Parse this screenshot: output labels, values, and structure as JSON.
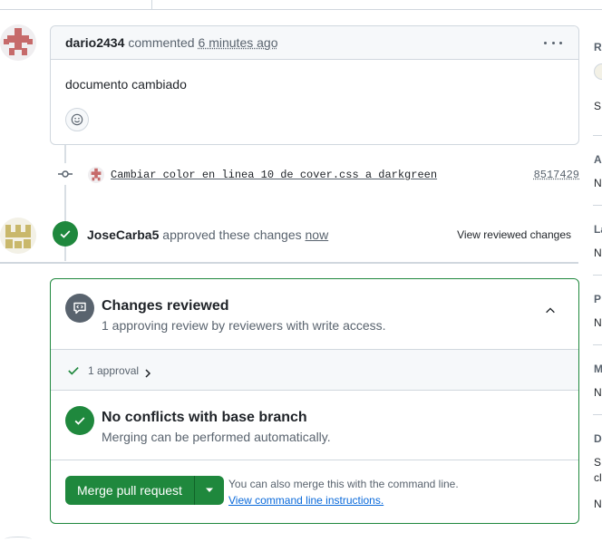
{
  "comment": {
    "author": "dario2434",
    "verb": "commented",
    "time": "6 minutes ago",
    "body": "documento cambiado"
  },
  "commit": {
    "message": "Cambiar color en linea 10 de cover.css a darkgreen",
    "sha": "8517429"
  },
  "review": {
    "author": "JoseCarba5",
    "verb": "approved these changes",
    "when": "now",
    "view_label": "View reviewed changes"
  },
  "merge": {
    "changes_title": "Changes reviewed",
    "changes_sub": "1 approving review by reviewers with write access.",
    "approvals_label": "1 approval",
    "conflicts_title": "No conflicts with base branch",
    "conflicts_sub": "Merging can be performed automatically.",
    "merge_button": "Merge pull request",
    "cmd_note": "You can also merge this with the command line.",
    "cmd_link": "View command line instructions."
  },
  "sidebar": {
    "fragments": [
      "R",
      "S",
      "A",
      "N",
      "La",
      "N",
      "P",
      "N",
      "M",
      "N",
      "D",
      "S",
      "cl",
      "N"
    ]
  },
  "colors": {
    "success": "#1f883d",
    "muted": "#59636e",
    "border": "#d0d7de",
    "link": "#0969da"
  }
}
